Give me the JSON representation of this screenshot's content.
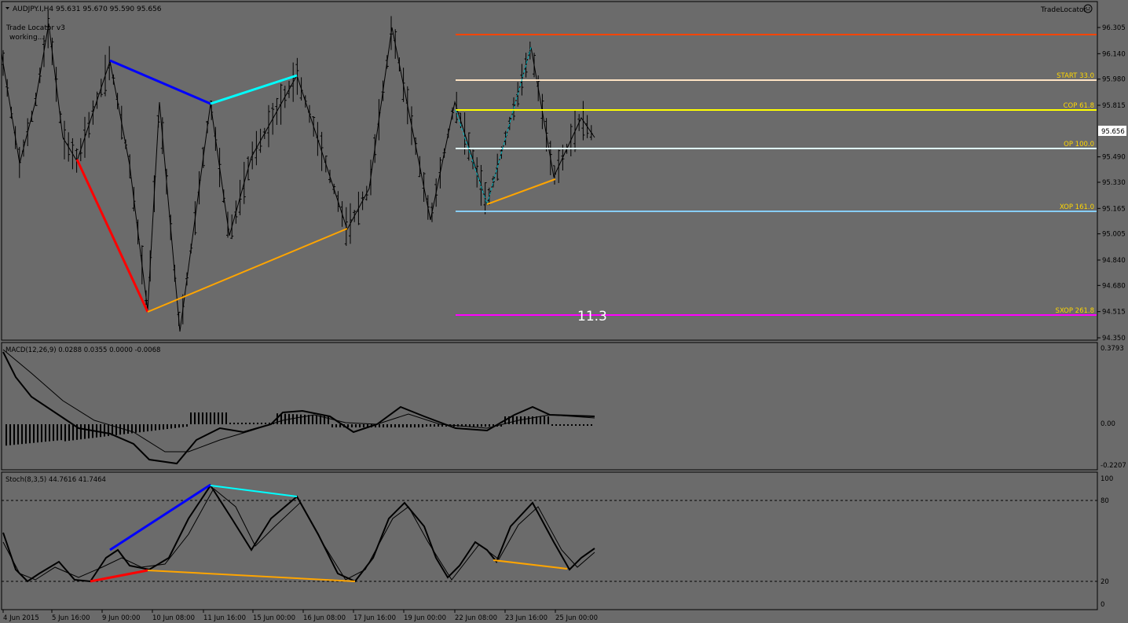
{
  "colors": {
    "background": "#6b6b6b",
    "candles": "#000000",
    "xabcd_xa": "#ff0000",
    "xabcd_ab": "#0000ff",
    "xabcd_bc": "#00ffff",
    "xabcd_cd": "#ffa500",
    "level_top": "#ff4500",
    "level_start": "#ffe4c4",
    "level_cop": "#ffff00",
    "level_op": "#e0ffff",
    "level_xop": "#87cefa",
    "level_sxop": "#ff00ff",
    "level_label": "#ffd700"
  },
  "header": {
    "symbol_line": "AUDJPY.I,H4  95.631 95.670 95.590 95.656",
    "brand": "TradeLocator",
    "brand_icon": "smiley-icon",
    "indicator_name": "Trade Locator v3",
    "indicator_status": "working..."
  },
  "main_chart": {
    "price_ticks": [
      "96.305",
      "96.140",
      "95.980",
      "95.815",
      "95.656",
      "95.490",
      "95.330",
      "95.165",
      "95.005",
      "94.840",
      "94.680",
      "94.515",
      "94.350"
    ],
    "current_price": "95.656",
    "levels": [
      {
        "id": "top",
        "label": "",
        "price": 96.29
      },
      {
        "id": "start",
        "label": "START 33.0",
        "price": 95.98
      },
      {
        "id": "cop",
        "label": "COP 61.8",
        "price": 95.8
      },
      {
        "id": "op",
        "label": "OP 100.0",
        "price": 95.56
      },
      {
        "id": "xop",
        "label": "XOP 161.0",
        "price": 95.16
      },
      {
        "id": "sxop",
        "label": "SXOP 261.8",
        "price": 94.51
      }
    ],
    "overlay_number": "11.3"
  },
  "macd": {
    "label": "MACD(12,26,9) 0.0288 0.0355 0.0000 -0.0068",
    "ticks": [
      "0.3793",
      "0.00",
      "-0.2207"
    ]
  },
  "stoch": {
    "label": "Stoch(8,3,5) 44.7616 41.7464",
    "ticks": [
      "100",
      "80",
      "20",
      "0"
    ]
  },
  "time_axis": [
    "4 Jun 2015",
    "5 Jun 16:00",
    "9 Jun 00:00",
    "10 Jun 08:00",
    "11 Jun 16:00",
    "15 Jun 00:00",
    "16 Jun 08:00",
    "17 Jun 16:00",
    "19 Jun 00:00",
    "22 Jun 08:00",
    "23 Jun 16:00",
    "25 Jun 00:00"
  ]
}
